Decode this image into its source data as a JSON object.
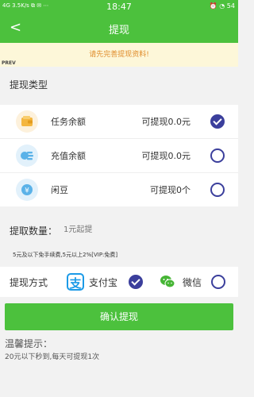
{
  "status_bar": {
    "left": "4G  3.5K/s  ⧉  ✉  ⋯",
    "time": "18:47",
    "right": "⏰ ◔ 54"
  },
  "nav": {
    "back_glyph": "<",
    "title": "提现"
  },
  "notice": "请先完善提现资料!",
  "prev_label": "PREV",
  "section_title": "提现类型",
  "options": [
    {
      "name": "任务余额",
      "available": "可提现0.0元",
      "icon": "wallet-icon",
      "checked": true
    },
    {
      "name": "充值余额",
      "available": "可提现0.0元",
      "icon": "coins-icon",
      "checked": false
    },
    {
      "name": "闲豆",
      "available": "可提现0个",
      "icon": "yen-icon",
      "checked": false
    }
  ],
  "amount": {
    "label": "提取数量：",
    "placeholder": "1元起提"
  },
  "fee_note": "5元及以下免手续费,5元以上2%[VIP:免费]",
  "method": {
    "label": "提现方式",
    "alipay": "支付宝",
    "wechat": "微信",
    "alipay_glyph": "支"
  },
  "confirm_label": "确认提现",
  "tips": {
    "title": "温馨提示：",
    "text": "20元以下秒到,每天可提现1次"
  },
  "colors": {
    "primary": "#4cc13d",
    "radio": "#3b3f9c",
    "notice_text": "#e08b2a",
    "notice_bg": "#fdf7d9"
  }
}
